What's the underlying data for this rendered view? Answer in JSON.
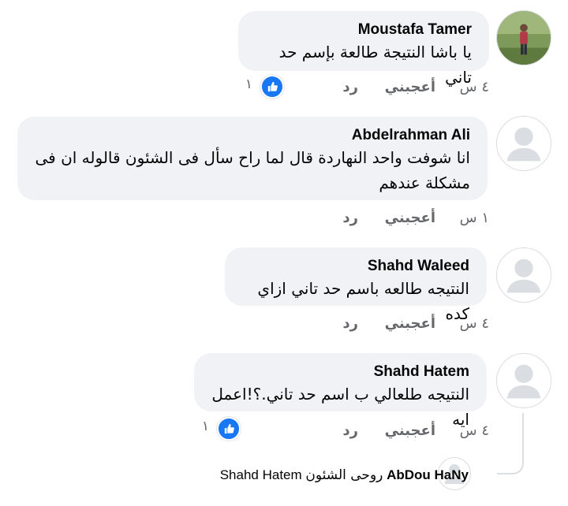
{
  "comments": [
    {
      "author": "Moustafa Tamer",
      "text": "يا باشا النتيجة طالعة بإسم حد تاني",
      "time": "٤ س",
      "like_label": "أعجبني",
      "reply_label": "رد",
      "reaction_count": "١"
    },
    {
      "author": "Abdelrahman Ali",
      "text": "انا شوفت واحد النهاردة قال لما راح سأل فى الشئون قالوله ان فى مشكلة عندهم",
      "time": "١ س",
      "like_label": "أعجبني",
      "reply_label": "رد"
    },
    {
      "author": "Shahd Waleed",
      "text": "النتيجه طالعه باسم حد تاني ازاي كده",
      "time": "٤ س",
      "like_label": "أعجبني",
      "reply_label": "رد"
    },
    {
      "author": "Shahd Hatem",
      "text": "النتيجه طلعالي ب اسم حد تاني.؟!اعمل ايه",
      "time": "٤ س",
      "like_label": "أعجبني",
      "reply_label": "رد",
      "reaction_count": "١"
    }
  ],
  "reply_preview": {
    "author": "AbDou HaNy",
    "text": "روحى الشئون",
    "mention": "Shahd Hatem"
  },
  "colors": {
    "bubble": "#f0f2f5",
    "secondary_text": "#65676b",
    "like_blue": "#1877f2"
  }
}
